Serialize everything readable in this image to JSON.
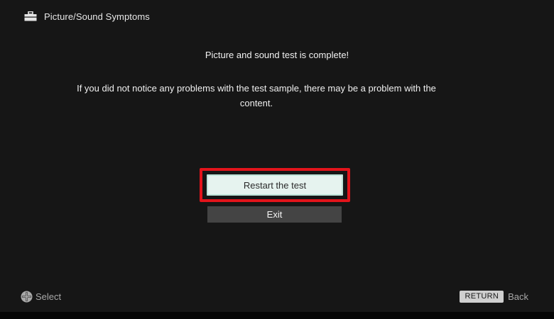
{
  "header": {
    "icon": "toolbox-icon",
    "title": "Picture/Sound Symptoms"
  },
  "message": {
    "main": "Picture and sound test is complete!",
    "sub": "If you did not notice any problems with the test sample, there may be a problem with the content."
  },
  "buttons": {
    "restart_label": "Restart the test",
    "exit_label": "Exit"
  },
  "footer": {
    "select_icon": "dpad-icon",
    "select_label": "Select",
    "return_key": "RETURN",
    "back_label": "Back"
  },
  "colors": {
    "background": "#161616",
    "highlight": "#e3141b",
    "selected_button": "#e6f3ef",
    "exit_button": "#444444"
  }
}
